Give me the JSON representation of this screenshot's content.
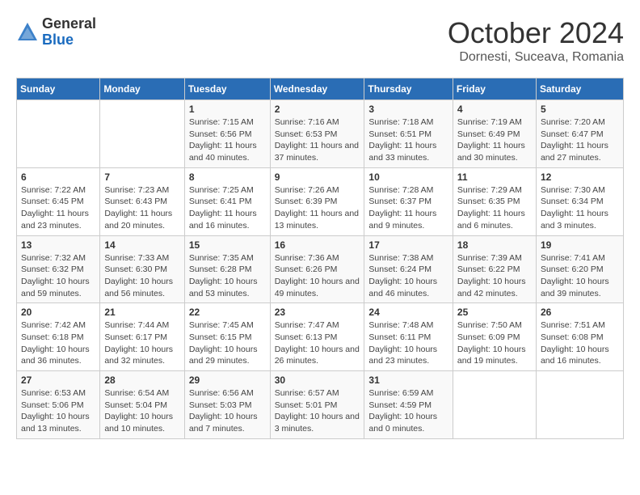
{
  "logo": {
    "general": "General",
    "blue": "Blue"
  },
  "title": "October 2024",
  "location": "Dornesti, Suceava, Romania",
  "days_of_week": [
    "Sunday",
    "Monday",
    "Tuesday",
    "Wednesday",
    "Thursday",
    "Friday",
    "Saturday"
  ],
  "weeks": [
    [
      {
        "day": "",
        "info": ""
      },
      {
        "day": "",
        "info": ""
      },
      {
        "day": "1",
        "info": "Sunrise: 7:15 AM\nSunset: 6:56 PM\nDaylight: 11 hours and 40 minutes."
      },
      {
        "day": "2",
        "info": "Sunrise: 7:16 AM\nSunset: 6:53 PM\nDaylight: 11 hours and 37 minutes."
      },
      {
        "day": "3",
        "info": "Sunrise: 7:18 AM\nSunset: 6:51 PM\nDaylight: 11 hours and 33 minutes."
      },
      {
        "day": "4",
        "info": "Sunrise: 7:19 AM\nSunset: 6:49 PM\nDaylight: 11 hours and 30 minutes."
      },
      {
        "day": "5",
        "info": "Sunrise: 7:20 AM\nSunset: 6:47 PM\nDaylight: 11 hours and 27 minutes."
      }
    ],
    [
      {
        "day": "6",
        "info": "Sunrise: 7:22 AM\nSunset: 6:45 PM\nDaylight: 11 hours and 23 minutes."
      },
      {
        "day": "7",
        "info": "Sunrise: 7:23 AM\nSunset: 6:43 PM\nDaylight: 11 hours and 20 minutes."
      },
      {
        "day": "8",
        "info": "Sunrise: 7:25 AM\nSunset: 6:41 PM\nDaylight: 11 hours and 16 minutes."
      },
      {
        "day": "9",
        "info": "Sunrise: 7:26 AM\nSunset: 6:39 PM\nDaylight: 11 hours and 13 minutes."
      },
      {
        "day": "10",
        "info": "Sunrise: 7:28 AM\nSunset: 6:37 PM\nDaylight: 11 hours and 9 minutes."
      },
      {
        "day": "11",
        "info": "Sunrise: 7:29 AM\nSunset: 6:35 PM\nDaylight: 11 hours and 6 minutes."
      },
      {
        "day": "12",
        "info": "Sunrise: 7:30 AM\nSunset: 6:34 PM\nDaylight: 11 hours and 3 minutes."
      }
    ],
    [
      {
        "day": "13",
        "info": "Sunrise: 7:32 AM\nSunset: 6:32 PM\nDaylight: 10 hours and 59 minutes."
      },
      {
        "day": "14",
        "info": "Sunrise: 7:33 AM\nSunset: 6:30 PM\nDaylight: 10 hours and 56 minutes."
      },
      {
        "day": "15",
        "info": "Sunrise: 7:35 AM\nSunset: 6:28 PM\nDaylight: 10 hours and 53 minutes."
      },
      {
        "day": "16",
        "info": "Sunrise: 7:36 AM\nSunset: 6:26 PM\nDaylight: 10 hours and 49 minutes."
      },
      {
        "day": "17",
        "info": "Sunrise: 7:38 AM\nSunset: 6:24 PM\nDaylight: 10 hours and 46 minutes."
      },
      {
        "day": "18",
        "info": "Sunrise: 7:39 AM\nSunset: 6:22 PM\nDaylight: 10 hours and 42 minutes."
      },
      {
        "day": "19",
        "info": "Sunrise: 7:41 AM\nSunset: 6:20 PM\nDaylight: 10 hours and 39 minutes."
      }
    ],
    [
      {
        "day": "20",
        "info": "Sunrise: 7:42 AM\nSunset: 6:18 PM\nDaylight: 10 hours and 36 minutes."
      },
      {
        "day": "21",
        "info": "Sunrise: 7:44 AM\nSunset: 6:17 PM\nDaylight: 10 hours and 32 minutes."
      },
      {
        "day": "22",
        "info": "Sunrise: 7:45 AM\nSunset: 6:15 PM\nDaylight: 10 hours and 29 minutes."
      },
      {
        "day": "23",
        "info": "Sunrise: 7:47 AM\nSunset: 6:13 PM\nDaylight: 10 hours and 26 minutes."
      },
      {
        "day": "24",
        "info": "Sunrise: 7:48 AM\nSunset: 6:11 PM\nDaylight: 10 hours and 23 minutes."
      },
      {
        "day": "25",
        "info": "Sunrise: 7:50 AM\nSunset: 6:09 PM\nDaylight: 10 hours and 19 minutes."
      },
      {
        "day": "26",
        "info": "Sunrise: 7:51 AM\nSunset: 6:08 PM\nDaylight: 10 hours and 16 minutes."
      }
    ],
    [
      {
        "day": "27",
        "info": "Sunrise: 6:53 AM\nSunset: 5:06 PM\nDaylight: 10 hours and 13 minutes."
      },
      {
        "day": "28",
        "info": "Sunrise: 6:54 AM\nSunset: 5:04 PM\nDaylight: 10 hours and 10 minutes."
      },
      {
        "day": "29",
        "info": "Sunrise: 6:56 AM\nSunset: 5:03 PM\nDaylight: 10 hours and 7 minutes."
      },
      {
        "day": "30",
        "info": "Sunrise: 6:57 AM\nSunset: 5:01 PM\nDaylight: 10 hours and 3 minutes."
      },
      {
        "day": "31",
        "info": "Sunrise: 6:59 AM\nSunset: 4:59 PM\nDaylight: 10 hours and 0 minutes."
      },
      {
        "day": "",
        "info": ""
      },
      {
        "day": "",
        "info": ""
      }
    ]
  ]
}
